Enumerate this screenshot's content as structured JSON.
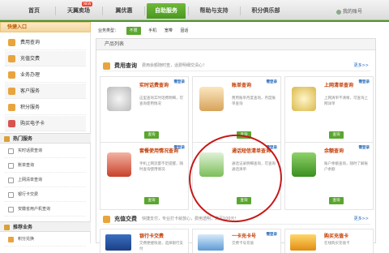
{
  "nav": {
    "items": [
      "首页",
      "天翼卖场",
      "翼优惠",
      "自助服务",
      "帮助与支持",
      "积分俱乐部"
    ],
    "badge": "NEW",
    "account": "我的账号"
  },
  "sidebar": {
    "head": "快捷入口",
    "items": [
      "费用查询",
      "充值交费",
      "业务办理",
      "客户服务",
      "积分服务",
      "购买电子卡"
    ],
    "hot_head": "热门服务",
    "hot_items": [
      "实时话费查询",
      "账单查询",
      "上网清单查询",
      "银行卡交费",
      "安徽省用户机查询"
    ],
    "rec_head": "推荐业务",
    "rec_items": [
      "积分兑换"
    ]
  },
  "filter": {
    "label": "业务类型：",
    "options": [
      "不限",
      "手机",
      "宽带",
      "固话"
    ]
  },
  "panel": {
    "title": "产品列表",
    "categories": [
      {
        "name": "费用查询",
        "desc": "费用余额随时查，话费明细交清心！",
        "more": "更多>>"
      },
      {
        "name": "充值交费",
        "desc": "快捷支付，专业打卡就放心，费用透明，满足100元！",
        "more": "更多>>"
      }
    ],
    "cards": [
      {
        "title": "实时话费查询",
        "text": "这里查询实时话费明细，可查询使用情况",
        "login": "需登录",
        "button": "查询"
      },
      {
        "title": "账单查询",
        "text": "费用账单月度查询，月度账单查询",
        "login": "需登录",
        "button": "查询"
      },
      {
        "title": "上网清单查询",
        "text": "上网清单不清晰，可查询上网详单",
        "login": "需登录",
        "button": "查询"
      },
      {
        "title": "套餐使用情况查询",
        "text": "手机上网流量不足提醒，随时查询使用情况",
        "login": "需登录",
        "button": "查询"
      },
      {
        "title": "通话短信清单查询",
        "text": "通话记录明细查询，可查询通话清单",
        "login": "需登录",
        "button": "查询"
      },
      {
        "title": "余额查询",
        "text": "账户余额查询，随时了解账户余额",
        "login": "需登录",
        "button": "查询"
      },
      {
        "title": "银行卡交费",
        "text": "交费便捷快速，选择银行支付",
        "login": ""
      },
      {
        "title": "一卡充卡号",
        "text": "交费卡号充值",
        "login": "需登录"
      },
      {
        "title": "购买充值卡",
        "text": "在线购买充值卡",
        "login": ""
      }
    ]
  }
}
